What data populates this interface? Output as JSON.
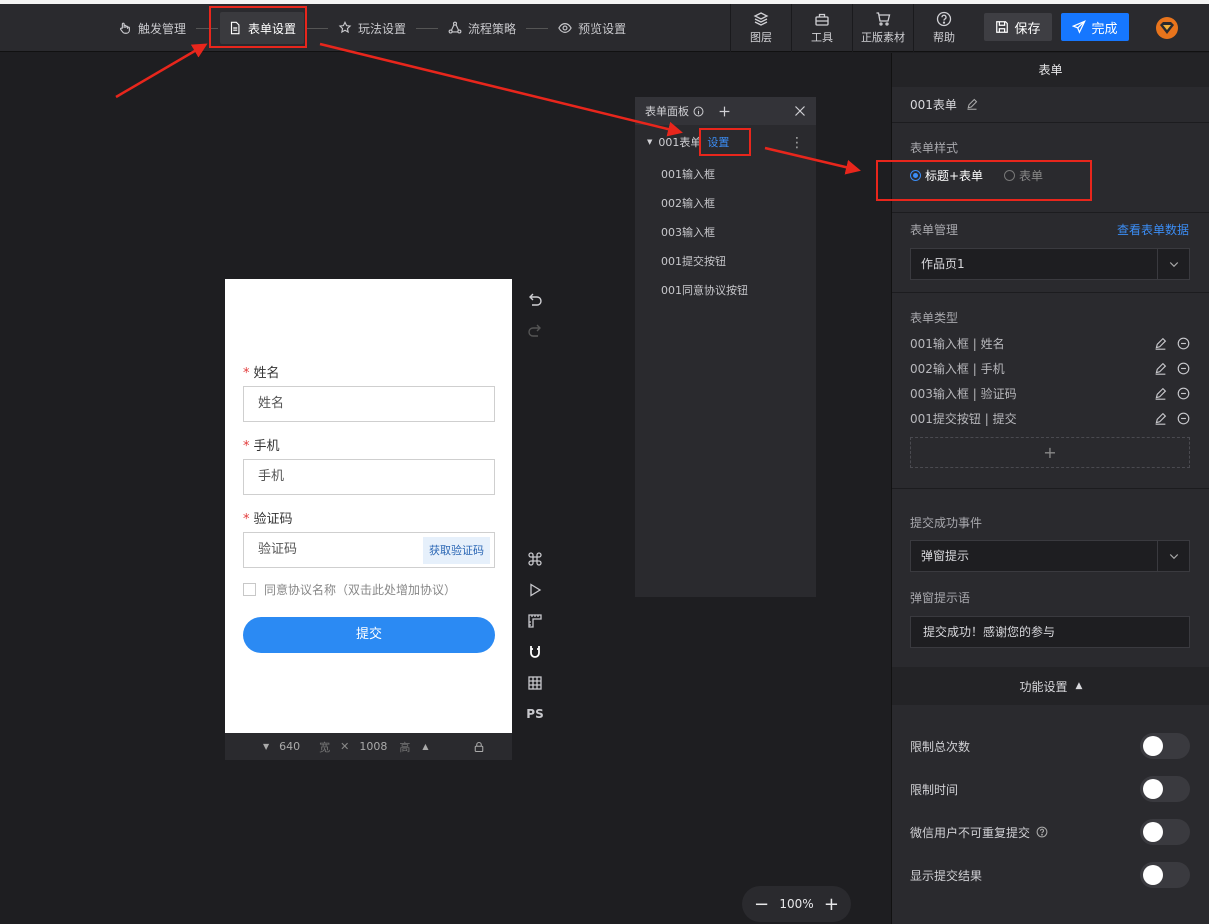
{
  "topbar": {
    "steps": [
      {
        "label": "触发管理",
        "icon": "hand-pointer-icon"
      },
      {
        "label": "表单设置",
        "icon": "document-icon",
        "active": true
      },
      {
        "label": "玩法设置",
        "icon": "star-gear-icon"
      },
      {
        "label": "流程策略",
        "icon": "flow-icon"
      },
      {
        "label": "预览设置",
        "icon": "eye-icon"
      }
    ],
    "tools": [
      {
        "label": "图层",
        "icon": "layers-icon"
      },
      {
        "label": "工具",
        "icon": "toolbox-icon"
      },
      {
        "label": "正版素材",
        "icon": "cart-icon"
      },
      {
        "label": "帮助",
        "icon": "question-icon"
      }
    ],
    "save_label": "保存",
    "done_label": "完成"
  },
  "phone": {
    "fields": [
      {
        "label": "姓名",
        "placeholder": "姓名",
        "required": true
      },
      {
        "label": "手机",
        "placeholder": "手机",
        "required": true
      },
      {
        "label": "验证码",
        "placeholder": "验证码",
        "required": true,
        "button": "获取验证码"
      }
    ],
    "agree_text": "同意协议名称（双击此处增加协议）",
    "submit_label": "提交",
    "width": "640",
    "width_unit": "宽",
    "height": "1008",
    "height_unit": "高",
    "required_mark": "*",
    "times_sign": "✕"
  },
  "side_tools": {
    "ps_label": "PS"
  },
  "form_panel": {
    "title": "表单面板",
    "root_label": "001表单",
    "settings_link": "设置",
    "items": [
      "001输入框",
      "002输入框",
      "003输入框",
      "001提交按钮",
      "001同意协议按钮"
    ]
  },
  "right_panel": {
    "title": "表单",
    "form_name": "001表单",
    "style_label": "表单样式",
    "style_options": [
      "标题+表单",
      "表单"
    ],
    "style_selected": 0,
    "manage_label": "表单管理",
    "view_data_link": "查看表单数据",
    "manage_value": "作品页1",
    "type_label": "表单类型",
    "types": [
      "001输入框 | 姓名",
      "002输入框 | 手机",
      "003输入框 | 验证码",
      "001提交按钮 | 提交"
    ],
    "add_symbol": "+",
    "success_event_label": "提交成功事件",
    "success_event_value": "弹窗提示",
    "popup_text_label": "弹窗提示语",
    "popup_text_value": "提交成功！感谢您的参与",
    "function_label": "功能设置",
    "toggles": [
      {
        "label": "限制总次数",
        "on": false
      },
      {
        "label": "限制时间",
        "on": false
      },
      {
        "label": "微信用户不可重复提交",
        "on": false,
        "help": true
      },
      {
        "label": "显示提交结果",
        "on": false
      }
    ]
  },
  "zoom": {
    "value": "100%",
    "minus": "−",
    "plus": "+"
  },
  "colors": {
    "accent": "#1677ff",
    "annotation": "#e8261c",
    "submit": "#2b8af3"
  }
}
